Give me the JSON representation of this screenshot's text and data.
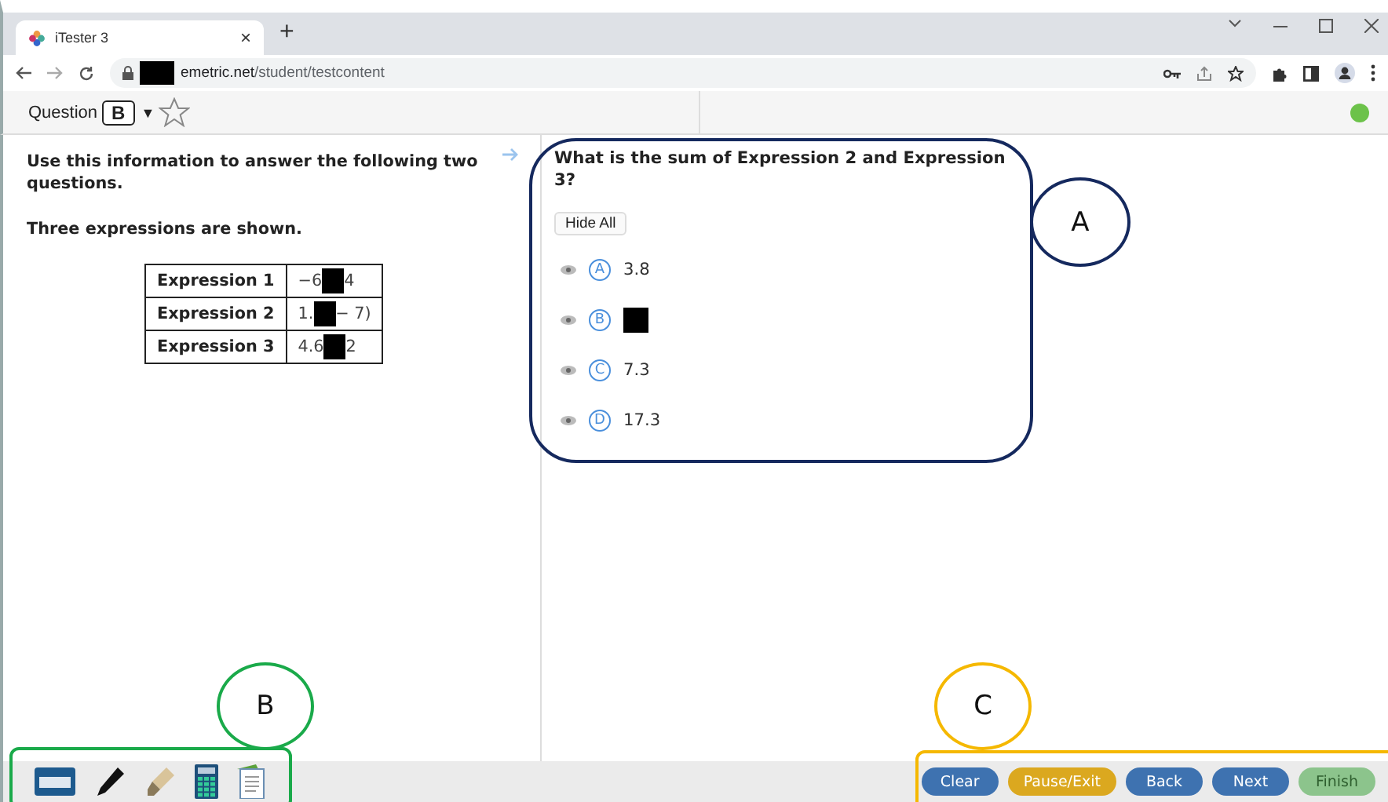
{
  "browser": {
    "tab_title": "iTester 3",
    "tab_close": "×",
    "new_tab": "+",
    "url_host": "emetric.net",
    "url_path": "/student/testcontent"
  },
  "toolbar": {
    "question_label": "Question",
    "question_number": "B",
    "dropdown": "▼",
    "bookmarked": false
  },
  "passage": {
    "paragraphs": [
      "Use this information to answer the following two questions.",
      "Three expressions are shown."
    ],
    "table": [
      {
        "name": "Expression 1",
        "value_parts": [
          "−6",
          "4"
        ]
      },
      {
        "name": "Expression 2",
        "value_parts": [
          "1.",
          "− 7)"
        ]
      },
      {
        "name": "Expression 3",
        "value_parts": [
          "4.6",
          "2"
        ]
      }
    ]
  },
  "question": {
    "prompt": "What is the sum of Expression 2 and Expression 3?",
    "hide_all": "Hide All",
    "options": [
      {
        "letter": "A",
        "text": "3.8",
        "redacted": false
      },
      {
        "letter": "B",
        "redacted": true
      },
      {
        "letter": "C",
        "text": "7.3",
        "redacted": false
      },
      {
        "letter": "D",
        "text": "17.3",
        "redacted": false
      }
    ]
  },
  "buttons": [
    {
      "label": "Clear",
      "kind": "primary",
      "disabled": false
    },
    {
      "label": "Pause/Exit",
      "kind": "warning",
      "disabled": false
    },
    {
      "label": "Back",
      "kind": "primary",
      "disabled": false
    },
    {
      "label": "Next",
      "kind": "primary",
      "disabled": false
    },
    {
      "label": "Finish",
      "kind": "success",
      "disabled": true
    }
  ],
  "annotations": [
    {
      "label": "A",
      "color": "#15295e"
    },
    {
      "label": "B",
      "color": "#1aaa4a"
    },
    {
      "label": "C",
      "color": "#f5b800"
    }
  ]
}
